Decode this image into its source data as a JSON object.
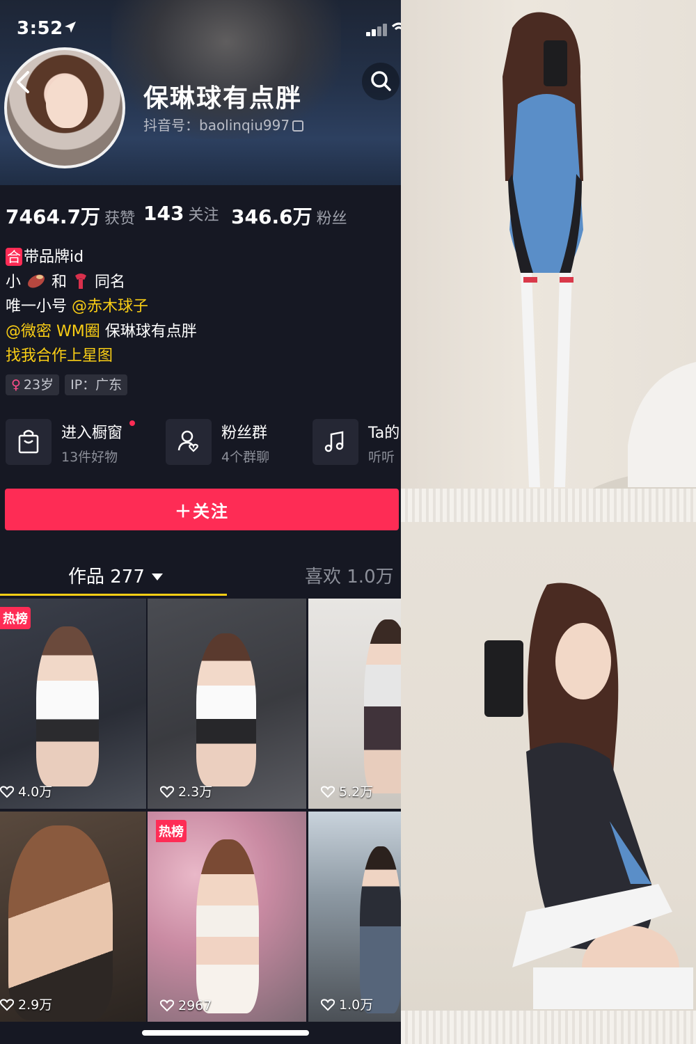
{
  "status_bar": {
    "time": "3:52"
  },
  "profile": {
    "nickname": "保琳球有点胖",
    "douyin_id": "抖音号：baolinqiu997"
  },
  "stats": [
    {
      "value": "7464.7万",
      "label": "获赞"
    },
    {
      "value": "143",
      "label": "关注"
    },
    {
      "value": "346.6万",
      "label": "粉丝"
    }
  ],
  "bio": {
    "line1_badge": "合",
    "line1_text": "带品牌id",
    "line2_a": "小",
    "line2_b": "和",
    "line2_c": "同名",
    "line3_prefix": "唯一小号",
    "line3_mention": "@赤木球子",
    "line4_mention": "@微密 WM圈",
    "line4_text": "保琳球有点胖",
    "line5_link": "找我合作上星图"
  },
  "tags": {
    "age": "23岁",
    "ip": "IP：广东"
  },
  "shortcuts": [
    {
      "title": "进入橱窗",
      "subtitle": "13件好物",
      "icon": "shopping-bag-icon"
    },
    {
      "title": "粉丝群",
      "subtitle": "4个群聊",
      "icon": "fan-group-icon"
    },
    {
      "title": "Ta的",
      "subtitle": "听听",
      "icon": "music-note-icon"
    }
  ],
  "follow_button": "＋关注",
  "tabs": {
    "works": "作品 277",
    "likes": "喜欢 1.0万"
  },
  "videos": [
    {
      "likes": "4.0万",
      "hot": "热榜"
    },
    {
      "likes": "2.3万",
      "hot": ""
    },
    {
      "likes": "5.2万",
      "hot": ""
    },
    {
      "likes": "2.9万",
      "hot": ""
    },
    {
      "likes": "2967",
      "hot": "热榜"
    },
    {
      "likes": "1.0万",
      "hot": ""
    }
  ],
  "colors": {
    "accent_red": "#fe2c55",
    "accent_gold": "#face15",
    "background": "#161823"
  }
}
